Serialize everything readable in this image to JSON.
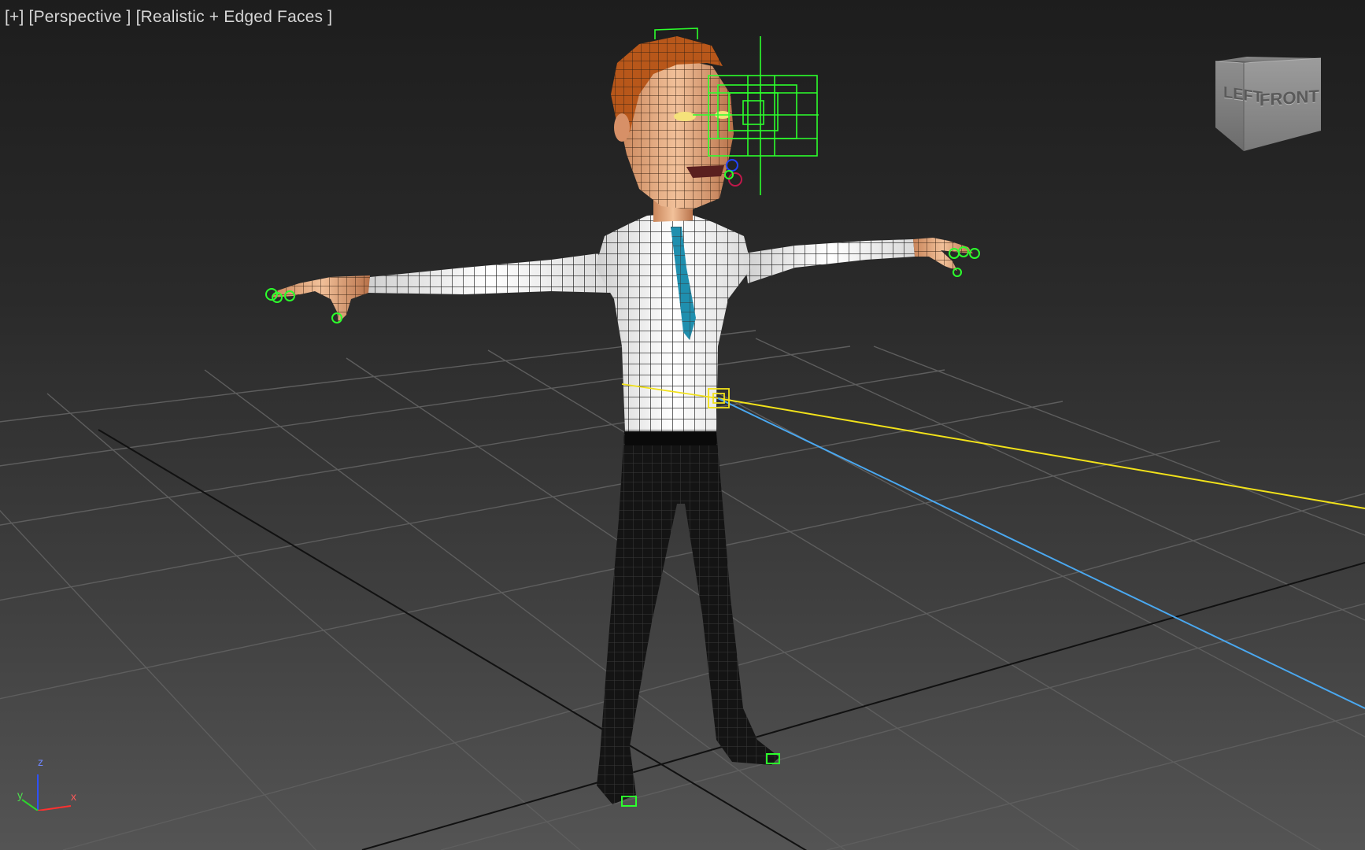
{
  "viewport": {
    "label_plus": "[+]",
    "label_view": "[Perspective ]",
    "label_shading": "[Realistic + Edged Faces ]"
  },
  "viewcube": {
    "left_face": "LEFT",
    "front_face": "FRONT"
  },
  "axis_tripod": {
    "z": "z",
    "y": "y",
    "x": "x"
  },
  "colors": {
    "grid_line": "#5e5e5e",
    "home_grid_axis": "#111111",
    "gizmo_green": "#2cff2c",
    "spline_yellow": "#f2e21a",
    "spline_blue": "#4aa8f0",
    "skin": "#e3a67b",
    "hair": "#b8571a",
    "shirt": "#f4f4f2",
    "tie": "#1f8fae",
    "pants": "#151515"
  }
}
